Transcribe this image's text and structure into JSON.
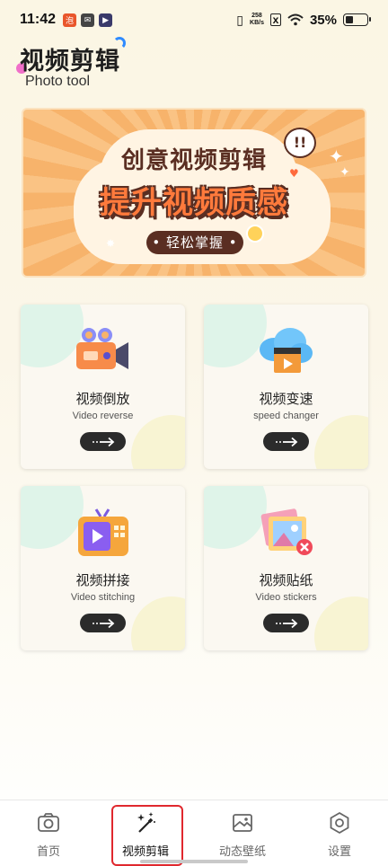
{
  "status_bar": {
    "time": "11:42",
    "net_speed": "258",
    "net_unit": "KB/s",
    "battery": "35%",
    "battery_level": 0.35
  },
  "header": {
    "title": "视频剪辑",
    "subtitle": "Photo tool"
  },
  "banner": {
    "line1": "创意视频剪辑",
    "line2": "提升视频质感",
    "pill": "• 轻松掌握 •",
    "bubble": "!!"
  },
  "tools": [
    {
      "label": "视频倒放",
      "sublabel": "Video reverse",
      "icon": "video-camera-icon"
    },
    {
      "label": "视频变速",
      "sublabel": "speed changer",
      "icon": "cloud-clapper-icon"
    },
    {
      "label": "视频拼接",
      "sublabel": "Video stitching",
      "icon": "tv-play-icon"
    },
    {
      "label": "视频贴纸",
      "sublabel": "Video stickers",
      "icon": "photo-sticker-icon"
    }
  ],
  "tabs": [
    {
      "label": "首页",
      "icon": "camera-icon",
      "active": false
    },
    {
      "label": "视频剪辑",
      "icon": "magic-wand-icon",
      "active": true
    },
    {
      "label": "动态壁纸",
      "icon": "image-icon",
      "active": false
    },
    {
      "label": "设置",
      "icon": "gear-icon",
      "active": false
    }
  ],
  "colors": {
    "accent_highlight": "#e0282e",
    "go_button": "#2b2b2b",
    "banner_orange": "#f7b36b"
  }
}
